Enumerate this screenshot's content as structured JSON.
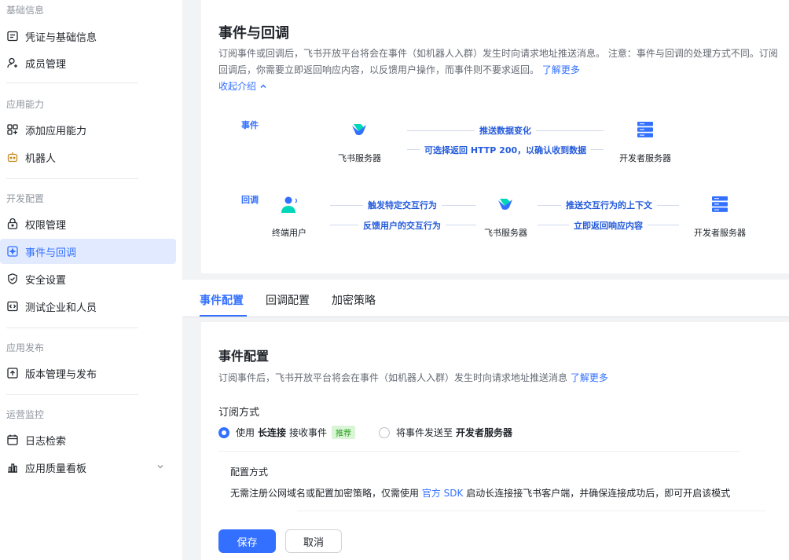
{
  "sidebar": {
    "groups": [
      {
        "title": "基础信息"
      },
      {
        "title": "应用能力"
      },
      {
        "title": "开发配置"
      },
      {
        "title": "应用发布"
      },
      {
        "title": "运营监控"
      }
    ],
    "items": [
      {
        "label": "凭证与基础信息",
        "icon": "credential-icon"
      },
      {
        "label": "成员管理",
        "icon": "user-icon"
      },
      {
        "label": "添加应用能力",
        "icon": "apps-icon"
      },
      {
        "label": "机器人",
        "icon": "robot-icon"
      },
      {
        "label": "权限管理",
        "icon": "lock-icon"
      },
      {
        "label": "事件与回调",
        "icon": "event-icon"
      },
      {
        "label": "安全设置",
        "icon": "shield-icon"
      },
      {
        "label": "测试企业和人员",
        "icon": "code-icon"
      },
      {
        "label": "版本管理与发布",
        "icon": "upload-icon"
      },
      {
        "label": "日志检索",
        "icon": "calendar-icon"
      },
      {
        "label": "应用质量看板",
        "icon": "chart-icon"
      }
    ],
    "active_index": 5
  },
  "intro": {
    "title": "事件与回调",
    "desc_1": "订阅事件或回调后，飞书开放平台将会在事件（如机器人入群）发生时向请求地址推送消息。 注意：事件与回调的处理方式不同。订阅回调后，你需要立即返回响应内容，以反馈用户操作，而事件则不要求返回。",
    "learn_more": "了解更多",
    "collapse": "收起介绍",
    "diagram": {
      "event_label": "事件",
      "callback_label": "回调",
      "feishu_server": "飞书服务器",
      "dev_server": "开发者服务器",
      "end_user": "终端用户",
      "push_data": "推送数据变化",
      "optional_return": "可选择返回 HTTP 200，以确认收到数据",
      "trigger": "触发特定交互行为",
      "feedback": "反馈用户的交互行为",
      "push_context": "推送交互行为的上下文",
      "return_now": "立即返回响应内容"
    }
  },
  "tabs": [
    "事件配置",
    "回调配置",
    "加密策略"
  ],
  "config": {
    "title": "事件配置",
    "desc": "订阅事件后，飞书开放平台将会在事件（如机器人入群）发生时向请求地址推送消息",
    "learn_more": "了解更多",
    "sub_title": "订阅方式",
    "option1_pre": "使用",
    "option1_strong": "长连接",
    "option1_post": "接收事件",
    "option1_tag": "推荐",
    "option2_pre": "将事件发送至",
    "option2_strong": "开发者服务器",
    "mode_title": "配置方式",
    "mode_desc_pre": "无需注册公网域名或配置加密策略，仅需使用",
    "mode_desc_link": "官方 SDK",
    "mode_desc_post": "启动长连接接飞书客户端，并确保连接成功后，即可开启该模式",
    "save": "保存",
    "cancel": "取消"
  },
  "colors": {
    "accent": "#3370ff",
    "active_bg": "#e1eaff",
    "tag_bg": "#d9f5d6",
    "tag_fg": "#2ea121"
  }
}
